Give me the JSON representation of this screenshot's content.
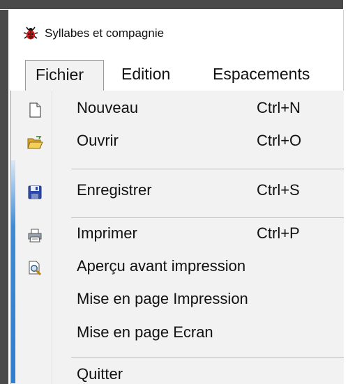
{
  "window": {
    "title": "Syllabes et compagnie",
    "title_icon": "ladybug-icon"
  },
  "menubar": {
    "items": [
      {
        "label": "Fichier",
        "open": true
      },
      {
        "label": "Edition"
      },
      {
        "label": "Espacements"
      }
    ]
  },
  "file_menu": {
    "items": [
      {
        "label": "Nouveau",
        "shortcut": "Ctrl+N",
        "icon": "new-document-icon"
      },
      {
        "label": "Ouvrir",
        "shortcut": "Ctrl+O",
        "icon": "open-folder-icon"
      },
      {
        "label": "Enregistrer",
        "shortcut": "Ctrl+S",
        "icon": "save-disk-icon"
      },
      {
        "label": "Imprimer",
        "shortcut": "Ctrl+P",
        "icon": "printer-icon"
      },
      {
        "label": "Aperçu avant impression",
        "icon": "print-preview-icon"
      },
      {
        "label": "Mise en page Impression"
      },
      {
        "label": "Mise en page Ecran"
      },
      {
        "label": "Quitter"
      }
    ]
  },
  "colors": {
    "menu_background": "#f2f2f2",
    "menu_border": "#9a9a9a",
    "window_border": "#4a4a4a",
    "accent_blue": "#2f7fd0"
  }
}
